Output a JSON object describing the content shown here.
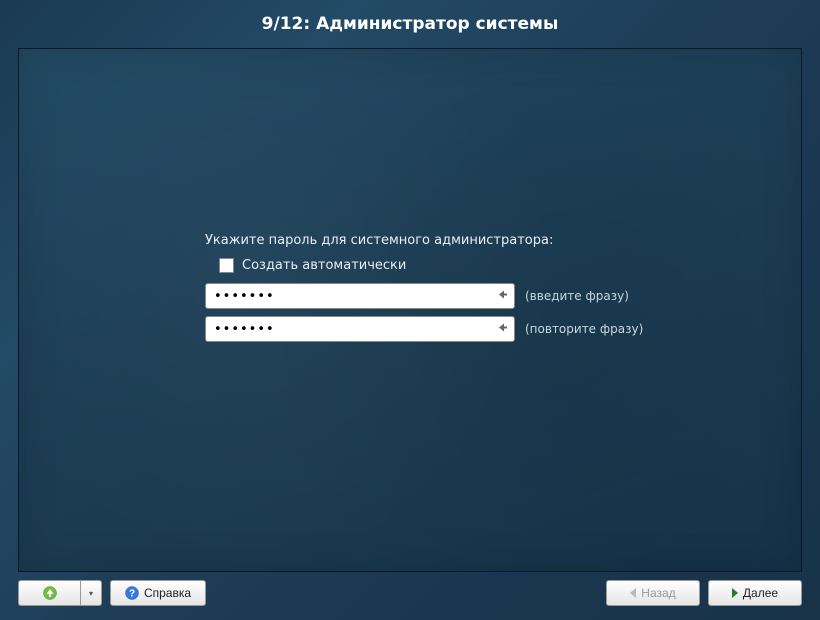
{
  "header": {
    "title": "9/12: Администратор системы"
  },
  "form": {
    "prompt": "Укажите пароль для системного администратора:",
    "auto_checkbox_label": "Создать автоматически",
    "auto_checkbox_checked": false,
    "password_value": "•••••••",
    "password_hint": "(введите фразу)",
    "confirm_value": "•••••••",
    "confirm_hint": "(повторите фразу)"
  },
  "footer": {
    "help_label": "Справка",
    "back_label": "Назад",
    "next_label": "Далее"
  },
  "icons": {
    "home": "home-icon",
    "dropdown": "chevron-down-icon",
    "help": "help-icon",
    "back": "chevron-left-icon",
    "next": "chevron-right-icon",
    "keyboard_indicator": "keyboard-layout-icon"
  }
}
